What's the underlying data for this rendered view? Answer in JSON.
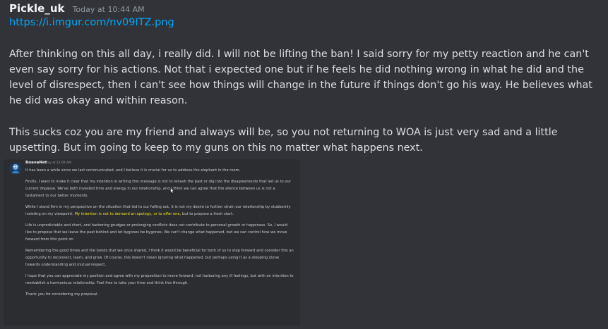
{
  "message": {
    "username": "Pickle_uk",
    "timestamp": "Today at 10:44 AM",
    "link": "https://i.imgur.com/nv09ITZ.png",
    "paragraphs": [
      "After thinking on this all day, i really did. I will not be lifting the ban! I said sorry for my petty reaction and he can't even say sorry for his actions. Not that i expected one but if he feels he did nothing wrong  in what he did and the  level of disrespect, then I can't see how things will change in the future if things don't go his way. He believes what he did was okay and within reason.",
      "This sucks coz you are my friend and always will be, so you not returning to WOA is just very sad and a little upsetting. But im going to keep to my guns on this no matter what happens next."
    ]
  },
  "embed": {
    "author": "BoavaNet",
    "timestamp": "Today at 12:09 AM",
    "intro": "It has been a while since we last communicated, and I believe it is crucial for us to address the elephant in the room.",
    "para1": "Firstly, I want to make it clear that my intention in writing this message is not to rehash the past or dig into the disagreements that led us to our current impasse. We've both invested time and energy in our relationship, and I think we can agree that the silence between us is not a testament to our better moments.",
    "para2_before": "While I stand firm in my perspective on the situation that led to our falling out, it is not my desire to further strain our relationship by stubbornly insisting on my viewpoint. ",
    "para2_highlight": "My intention is not to demand an apology, or to offer one,",
    "para2_after": " but to propose a fresh start.",
    "para3": "Life is unpredictable and short, and harboring grudges or prolonging conflicts does not contribute to personal growth or happiness. So, I would like to propose that we leave the past behind and let bygones be bygones. We can't change what happened, but we can control how we move forward from this point on.",
    "para4": "Remembering the good times and the bonds that we once shared, I think it would be beneficial for both of us to step forward and consider this an opportunity to reconnect, learn, and grow. Of course, this doesn't mean ignoring what happened, but perhaps using it as a stepping stone towards understanding and mutual respect.",
    "para5": "I hope that you can appreciate my position and agree with my proposition to move forward, not harboring any ill feelings, but with an intention to reestablish a harmonious relationship. Feel free to take your time and think this through.",
    "closing": "Thank you for considering my proposal."
  },
  "colors": {
    "background": "#313338",
    "username": "#f2f3f5",
    "timestamp": "#949ba4",
    "link": "#00a8fc",
    "text": "#dbdee1",
    "highlight": "#f0e020"
  }
}
